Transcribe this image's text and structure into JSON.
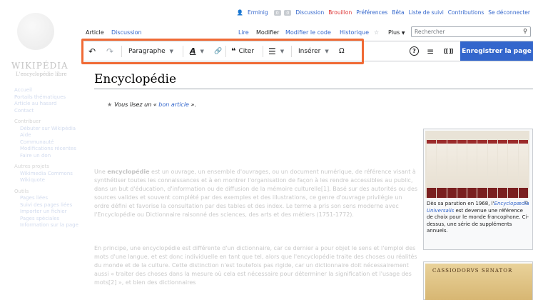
{
  "logo": {
    "wordmark": "WIKIPÉDIA",
    "tagline": "L'encyclopédie libre"
  },
  "sidebar": {
    "groups": [
      {
        "heading": "",
        "items": [
          "Accueil",
          "Portails thématiques",
          "Article au hasard",
          "Contact"
        ]
      },
      {
        "heading": "Contribuer",
        "items": [
          "Débuter sur Wikipédia",
          "Aide",
          "Communauté",
          "Modifications récentes",
          "Faire un don"
        ]
      },
      {
        "heading": "Autres projets",
        "items": [
          "Wikimedia Commons",
          "Wikiquote"
        ]
      },
      {
        "heading": "Outils",
        "items": [
          "Pages liées",
          "Suivi des pages liées",
          "Importer un fichier",
          "Pages spéciales",
          "Information sur la page"
        ]
      }
    ]
  },
  "userbar": {
    "username": "Erminig",
    "badge1": "0",
    "badge2": "0",
    "links": [
      "Discussion",
      "Brouillon",
      "Préférences",
      "Bêta",
      "Liste de suivi",
      "Contributions",
      "Se déconnecter"
    ]
  },
  "tabs": {
    "article": "Article",
    "discussion": "Discussion",
    "read": "Lire",
    "edit": "Modifier",
    "edit_source": "Modifier le code",
    "history": "Historique",
    "more": "Plus",
    "search_placeholder": "Rechercher"
  },
  "toolbar": {
    "undo_icon": "↶",
    "redo_icon": "↷",
    "paragraph": "Paragraphe",
    "text_style_icon": "A",
    "link_icon": "🔗",
    "cite_icon": "❝",
    "cite": "Citer",
    "list_icon": "☰",
    "insert": "Insérer",
    "special_char": "Ω",
    "help_icon": "?",
    "menu_icon": "≡",
    "source_icon": "[[ ]]",
    "save": "Enregistrer la page"
  },
  "article": {
    "title": "Encyclopédie",
    "notice_prefix": "Vous lisez un « ",
    "notice_link": "bon article",
    "notice_suffix": " ».",
    "p1_start": "Une ",
    "p1_bold": "encyclopédie",
    "p1_rest": " est un ouvrage, un ensemble d'ouvrages, ou un document numérique, de référence visant à synthétiser toutes les connaissances et à en montrer l'organisation de façon à les rendre accessibles au public, dans un but d'éducation, d'information ou de diffusion de la mémoire culturelle[1]. Basé sur des autorités ou des sources valides et souvent complété par des exemples et des illustrations, ce genre d'ouvrage privilégie un ordre défini et favorise la consultation par des tables et des index. Le terme a pris son sens moderne avec l'Encyclopédie ou Dictionnaire raisonné des sciences, des arts et des métiers (1751-1772).",
    "p2": "En principe, une encyclopédie est différente d'un dictionnaire, car ce dernier a pour objet le sens et l'emploi des mots d'une langue, et est donc individuelle en tant que tel, alors que l'encyclopédie traite des choses ou réalités du monde et de la culture. Cette distinction n'est toutefois pas rigide, car un dictionnaire doit nécessairement aussi « traiter des choses dans la mesure où cela est nécessaire pour déterminer la signification et l'usage des mots[2] », et bien des dictionnaires"
  },
  "infobox": {
    "caption_prefix": "Dès sa parution en 1968, l'",
    "caption_link": "Encyclopædia Universalis",
    "caption_suffix": " est devenue une référence de choix pour le monde francophone. Ci-dessus, une série de suppléments annuels.",
    "image2_text": "CASSIODORVS SENATOR"
  }
}
